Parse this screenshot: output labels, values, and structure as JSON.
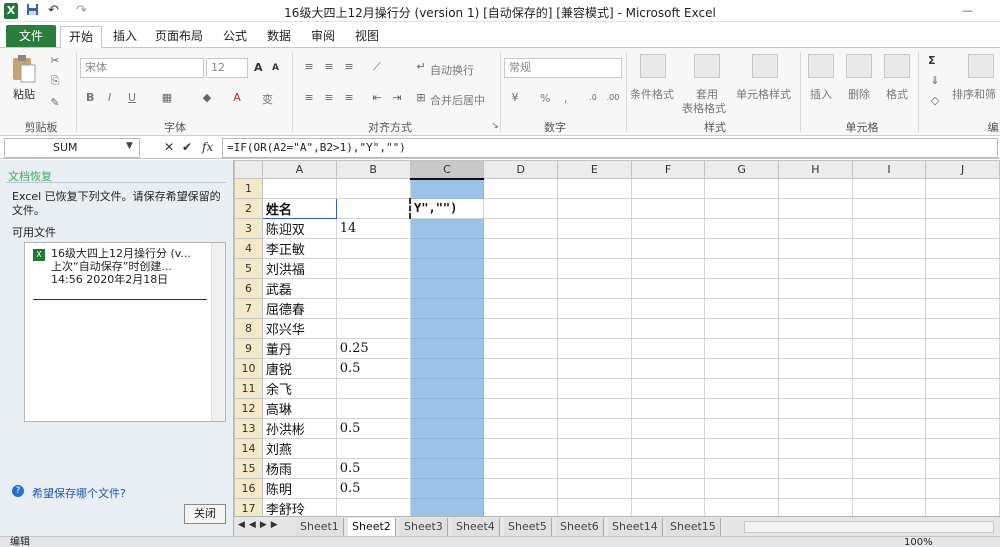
{
  "window": {
    "title": "16级大四上12月操行分 (version 1) [自动保存的] [兼容模式] - Microsoft Excel",
    "app_icon": "X",
    "save_icon": "save-icon",
    "undo_glyph": "↶",
    "redo_glyph": "↷",
    "minimize_glyph": "—"
  },
  "tabs": [
    "文件",
    "开始",
    "插入",
    "页面布局",
    "公式",
    "数据",
    "审阅",
    "视图"
  ],
  "ribbon": {
    "clipboard": {
      "paste_label": "粘贴",
      "group_label": "剪贴板"
    },
    "font": {
      "font_name": "宋体",
      "font_size": "12",
      "grow": "A",
      "shrink": "A",
      "bold": "B",
      "italic": "I",
      "underline": "U",
      "phonetic": "变",
      "group_label": "字体"
    },
    "alignment": {
      "wrap_label": "自动换行",
      "merge_label": "合并后居中",
      "group_label": "对齐方式"
    },
    "number": {
      "format": "常规",
      "percent": "%",
      "comma": ",",
      "group_label": "数字"
    },
    "styles": {
      "conditional": "条件格式",
      "table_line1": "套用",
      "table_line2": "表格格式",
      "cell_styles": "单元格样式",
      "group_label": "样式"
    },
    "cells": {
      "insert": "插入",
      "delete": "删除",
      "format": "格式",
      "group_label": "单元格"
    },
    "editing": {
      "sigma": "Σ",
      "sort": "排序和筛",
      "group_label": "编"
    }
  },
  "formula_bar": {
    "name_box": "SUM",
    "cancel": "✕",
    "enter": "✔",
    "fx": "fx",
    "formula": "=IF(OR(A2=\"A\",B2>1),\"Y\",\"\")"
  },
  "recovery_pane": {
    "title": "文档恢复",
    "message": "Excel 已恢复下列文件。请保存希望保留的文件。",
    "available": "可用文件",
    "file_name": "16级大四上12月操行分 (v...",
    "file_note": "上次“自动保存”时创建...",
    "file_time": "14:56 2020年2月18日",
    "help_link": "希望保存哪个文件?",
    "close_button": "关闭"
  },
  "sheet": {
    "columns": [
      "A",
      "B",
      "C",
      "D",
      "E",
      "F",
      "G",
      "H",
      "I",
      "J"
    ],
    "rows": [
      {
        "n": "1",
        "a": "",
        "b": "",
        "c": ""
      },
      {
        "n": "2",
        "a": "姓名",
        "b": "",
        "c": "Y\",\"\")"
      },
      {
        "n": "3",
        "a": "陈迎双",
        "b": "14",
        "c": ""
      },
      {
        "n": "4",
        "a": "李正敏",
        "b": "",
        "c": ""
      },
      {
        "n": "5",
        "a": "刘洪福",
        "b": "",
        "c": ""
      },
      {
        "n": "6",
        "a": "武磊",
        "b": "",
        "c": ""
      },
      {
        "n": "7",
        "a": "屈德春",
        "b": "",
        "c": ""
      },
      {
        "n": "8",
        "a": "邓兴华",
        "b": "",
        "c": ""
      },
      {
        "n": "9",
        "a": "董丹",
        "b": "0.25",
        "c": ""
      },
      {
        "n": "10",
        "a": "唐锐",
        "b": "0.5",
        "c": ""
      },
      {
        "n": "11",
        "a": "余飞",
        "b": "",
        "c": ""
      },
      {
        "n": "12",
        "a": "高琳",
        "b": "",
        "c": ""
      },
      {
        "n": "13",
        "a": "孙洪彬",
        "b": "0.5",
        "c": ""
      },
      {
        "n": "14",
        "a": "刘燕",
        "b": "",
        "c": ""
      },
      {
        "n": "15",
        "a": "杨雨",
        "b": "0.5",
        "c": ""
      },
      {
        "n": "16",
        "a": "陈明",
        "b": "0.5",
        "c": ""
      },
      {
        "n": "17",
        "a": "李舒玲",
        "b": "",
        "c": ""
      }
    ],
    "tabs": [
      "Sheet1",
      "Sheet2",
      "Sheet3",
      "Sheet4",
      "Sheet5",
      "Sheet6",
      "Sheet14",
      "Sheet15"
    ],
    "active_tab": "Sheet2"
  },
  "status": {
    "mode": "编辑",
    "zoom": "100%"
  },
  "colors": {
    "file_tab": "#2a7d3a",
    "selection": "#9cc2ea",
    "row_header": "#f3e9c8"
  }
}
